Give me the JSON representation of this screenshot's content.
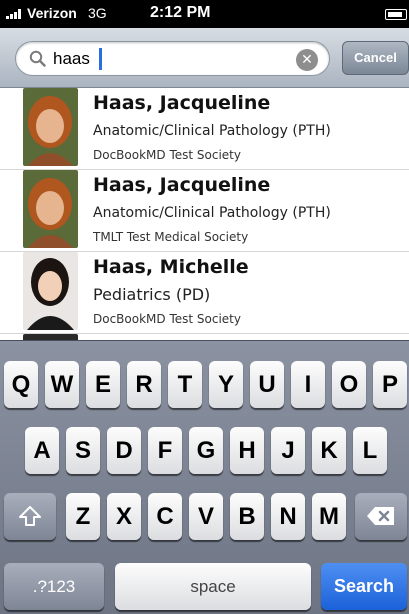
{
  "status_bar": {
    "carrier": "Verizon",
    "network": "3G",
    "time": "2:12 PM"
  },
  "search": {
    "value": "haas",
    "cancel_label": "Cancel"
  },
  "results": [
    {
      "name": "Haas, Jacqueline",
      "specialty": "Anatomic/Clinical Pathology (PTH)",
      "society": "DocBookMD Test Society"
    },
    {
      "name": "Haas, Jacqueline",
      "specialty": "Anatomic/Clinical Pathology (PTH)",
      "society": "TMLT Test  Medical Society"
    },
    {
      "name": "Haas, Michelle",
      "specialty": "Pediatrics (PD)",
      "society": "DocBookMD Test Society"
    }
  ],
  "keyboard": {
    "row1": [
      "Q",
      "W",
      "E",
      "R",
      "T",
      "Y",
      "U",
      "I",
      "O",
      "P"
    ],
    "row2": [
      "A",
      "S",
      "D",
      "F",
      "G",
      "H",
      "J",
      "K",
      "L"
    ],
    "row3": [
      "Z",
      "X",
      "C",
      "V",
      "B",
      "N",
      "M"
    ],
    "numbers_label": ".?123",
    "space_label": "space",
    "search_label": "Search",
    "shift_icon": "shift-icon",
    "backspace_icon": "backspace-icon"
  },
  "colors": {
    "accent": "#1b62d9",
    "status_bar": "#000000"
  }
}
